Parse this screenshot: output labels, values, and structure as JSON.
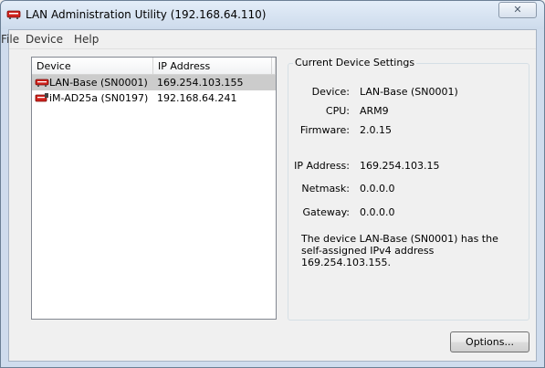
{
  "window": {
    "title": "LAN Administration Utility (192.168.64.110)",
    "close_glyph": "✕"
  },
  "menu": [
    "File",
    "Device",
    "Help"
  ],
  "device_list": {
    "columns": [
      "Device",
      "IP Address"
    ],
    "rows": [
      {
        "device": "LAN-Base (SN0001)",
        "ip": "169.254.103.155",
        "selected": true
      },
      {
        "device": "iM-AD25a (SN0197)",
        "ip": "192.168.64.241",
        "selected": false
      }
    ]
  },
  "settings": {
    "group_title": "Current Device Settings",
    "device_label": "Device:",
    "device_value": "LAN-Base (SN0001)",
    "cpu_label": "CPU:",
    "cpu_value": "ARM9",
    "firmware_label": "Firmware:",
    "firmware_value": "2.0.15",
    "ip_label": "IP Address:",
    "ip_value": "169.254.103.15",
    "netmask_label": "Netmask:",
    "netmask_value": "0.0.0.0",
    "gateway_label": "Gateway:",
    "gateway_value": "0.0.0.0",
    "message": "The device LAN-Base (SN0001) has the self-assigned IPv4 address 169.254.103.155."
  },
  "buttons": {
    "options": "Options..."
  },
  "colors": {
    "device_icon_red": "#d0221c",
    "selection": "#cccccc"
  }
}
